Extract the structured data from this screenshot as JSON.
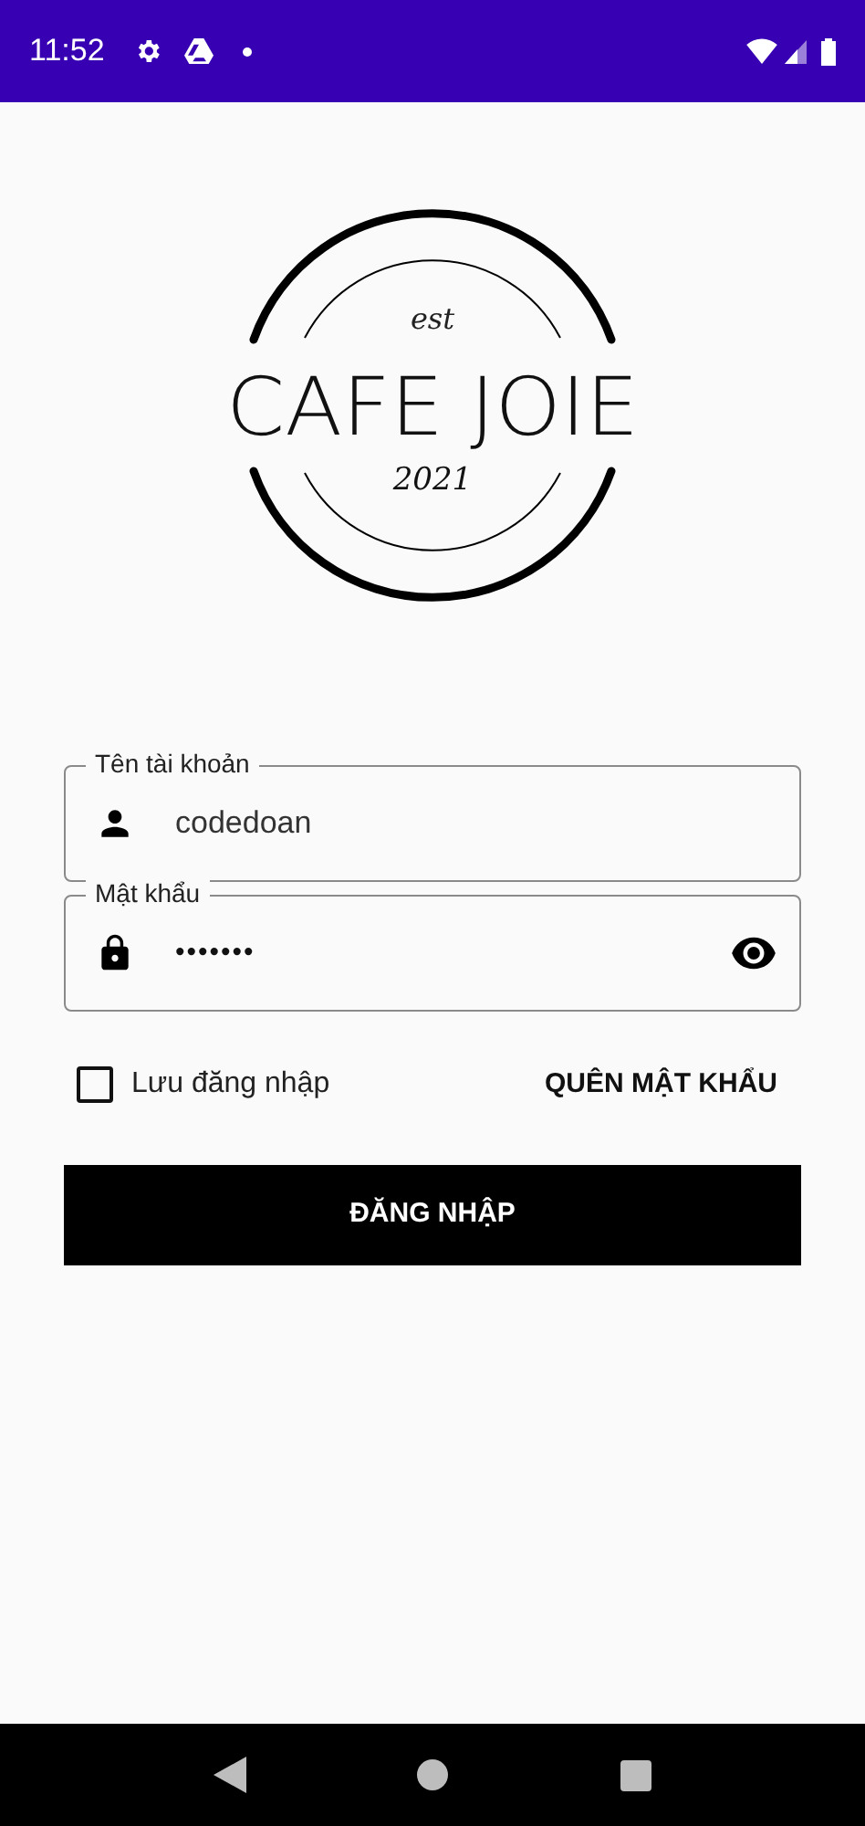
{
  "status_bar": {
    "time": "11:52"
  },
  "logo": {
    "top": "est",
    "name": "CAFE JOIE",
    "year": "2021"
  },
  "fields": [
    {
      "kind": "user",
      "label": "Tên tài khoản",
      "value": "codedoan"
    },
    {
      "kind": "password",
      "label": "Mật khẩu",
      "value": "•••••••"
    }
  ],
  "remember": {
    "label": "Lưu đăng nhập",
    "checked": false
  },
  "forgot_link": "QUÊN MẬT KHẨU",
  "login_button": "ĐĂNG NHẬP"
}
